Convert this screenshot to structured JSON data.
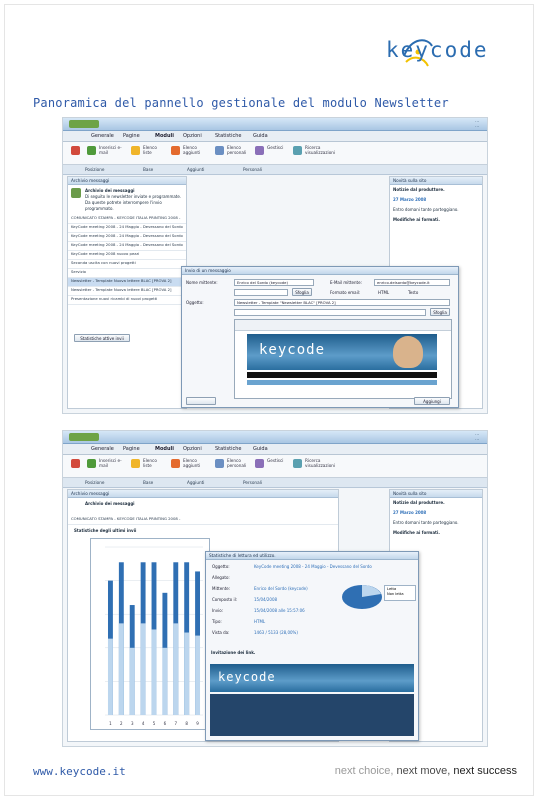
{
  "brand": {
    "logo_text": "keycode",
    "accent": "#2b6cb0",
    "url": "www.keycode.it",
    "tagline": {
      "part1": "next choice, ",
      "part2": "next move, ",
      "part3": "next success"
    }
  },
  "page": {
    "title": "Panoramica del pannello gestionale del modulo Newsletter"
  },
  "screenshot_top": {
    "menu": [
      "Generale",
      "Pagine",
      "Moduli",
      "Opzioni",
      "Statistiche",
      "Guida"
    ],
    "tools": [
      "Inserisci e-mail",
      "Elenco liste",
      "Elenco aggiunti",
      "Elenco personali",
      "Gestisci",
      "Ricerca visualizzazioni"
    ],
    "subbar": [
      "Posizione",
      "Base",
      "Aggiunti",
      "Personali"
    ],
    "left_title": "Archivio messaggi",
    "left_heading": "Archivio dei messaggi",
    "left_desc": "Di seguito le newsletter inviate e programmate. Da queste potrete interrompere l'invio programmato.",
    "rows": [
      "COMUNICATO STAMPA - KEYCODE ITALIA PRINTING 2008 -",
      "KeyCode meeting 2008 - 24 Maggio - Devessano del Sordo",
      "KeyCode meeting 2008 - 24 Maggio - Devessano del Sordo",
      "KeyCode meeting 2008 - 24 Maggio - Devessano del Sordo",
      "KeyCode meeting 2008 nuovo pezzi",
      "Seconda uscita con nuovi progetti",
      "Servizio",
      "Newsletter - Template Nuova lettere BLAC [PROVA 2]",
      "Newsletter - Template Nuova lettere BLAC [PROVA 2]",
      "Presentazione nuovi ricambi di nuovi progetti"
    ],
    "right_title": "Novità sulla sito",
    "right_heading": "Notizie dal produttore.",
    "right_date": "27 Marzo 2008",
    "right_text": "Entro domani tante parteggiano.",
    "right_heading2": "Modifiche ai formati.",
    "dialog_title": "Invio di un messaggio",
    "sender_label": "Nome mittente:",
    "sender_value": "Enrico del Sordo (keycode)",
    "email_label": "E-Mail mittente:",
    "email_value": "enrico.delsordo@keycode.it",
    "subject_label": "Oggetto:",
    "subject_value": "Newsletter - Template \"Newsletter BLAC\" [PROVA 2]",
    "format_label": "Formato email:",
    "format_html": "HTML",
    "format_text": "Testo",
    "browse_button": "Sfoglia",
    "send_button": "Aggiungi",
    "banner_logo": "keycode",
    "close_button": "Statistiche attive invii"
  },
  "screenshot_bottom": {
    "left_heading": "Archivio dei messaggi",
    "stats_title": "Statistiche degli ultimi invii",
    "dialog_title": "Statistiche di lettura ed utilizzo.",
    "fields": [
      {
        "label": "Oggetto:",
        "value": "KeyCode meeting 2008 - 24 Maggio - Devessano del Sordo"
      },
      {
        "label": "Allegato:",
        "value": ""
      },
      {
        "label": "Mittente:",
        "value": "Enrico del Sordo (keycode)"
      },
      {
        "label": "Composto il:",
        "value": "15/04/2008"
      },
      {
        "label": "Invio:",
        "value": "15/04/2008 alle 15:57:06"
      },
      {
        "label": "Tipo:",
        "value": "HTML"
      },
      {
        "label": "Vista da:",
        "value": "1463 / 5133 (28,00%)"
      }
    ],
    "pie_legend": [
      "Letta",
      "Non letta"
    ],
    "invitation_label": "Invitazione dei link.",
    "banner_logo": "keycode"
  },
  "chart_data": {
    "type": "bar",
    "categories": [
      "1",
      "2",
      "3",
      "4",
      "5",
      "6",
      "7",
      "8",
      "9"
    ],
    "series": [
      {
        "values": [
          4400,
          5000,
          3600,
          5000,
          5000,
          4000,
          5000,
          5000,
          4700
        ]
      },
      {
        "values": [
          2500,
          3000,
          2200,
          3000,
          2800,
          2200,
          3000,
          2700,
          2600
        ]
      }
    ],
    "ylim": [
      0,
      5500
    ],
    "colors": [
      "#2f6fb3",
      "#bcd6ee"
    ]
  }
}
